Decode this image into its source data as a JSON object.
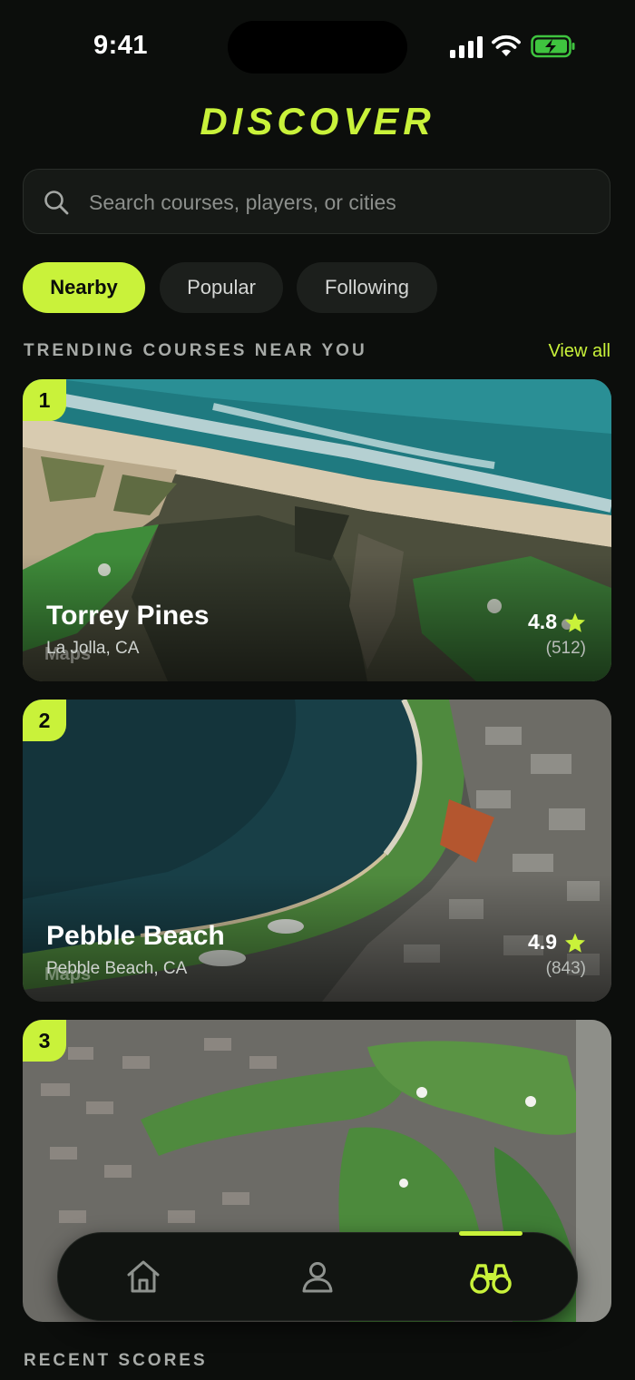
{
  "status_bar": {
    "time": "9:41"
  },
  "header": {
    "title": "DISCOVER"
  },
  "search": {
    "placeholder": "Search courses, players, or cities"
  },
  "filters": [
    {
      "label": "Nearby",
      "active": true
    },
    {
      "label": "Popular",
      "active": false
    },
    {
      "label": "Following",
      "active": false
    }
  ],
  "trending": {
    "title": "TRENDING COURSES NEAR YOU",
    "view_all": "View all",
    "courses": [
      {
        "rank": "1",
        "name": "Torrey Pines",
        "location": "La Jolla, CA",
        "rating": "4.8",
        "reviews": "(512)",
        "map_credit": "Maps"
      },
      {
        "rank": "2",
        "name": "Pebble Beach",
        "location": "Pebble Beach, CA",
        "rating": "4.9",
        "reviews": "(843)",
        "map_credit": "Maps"
      },
      {
        "rank": "3",
        "name": "",
        "location": "",
        "rating": "",
        "reviews": "",
        "map_credit": ""
      }
    ]
  },
  "recent": {
    "title": "RECENT SCORES"
  },
  "colors": {
    "accent": "#c9f23a",
    "background": "#0c0e0c"
  },
  "tabbar": {
    "tabs": [
      {
        "icon": "home-icon",
        "active": false
      },
      {
        "icon": "profile-icon",
        "active": false
      },
      {
        "icon": "binoculars-icon",
        "active": true
      }
    ]
  }
}
